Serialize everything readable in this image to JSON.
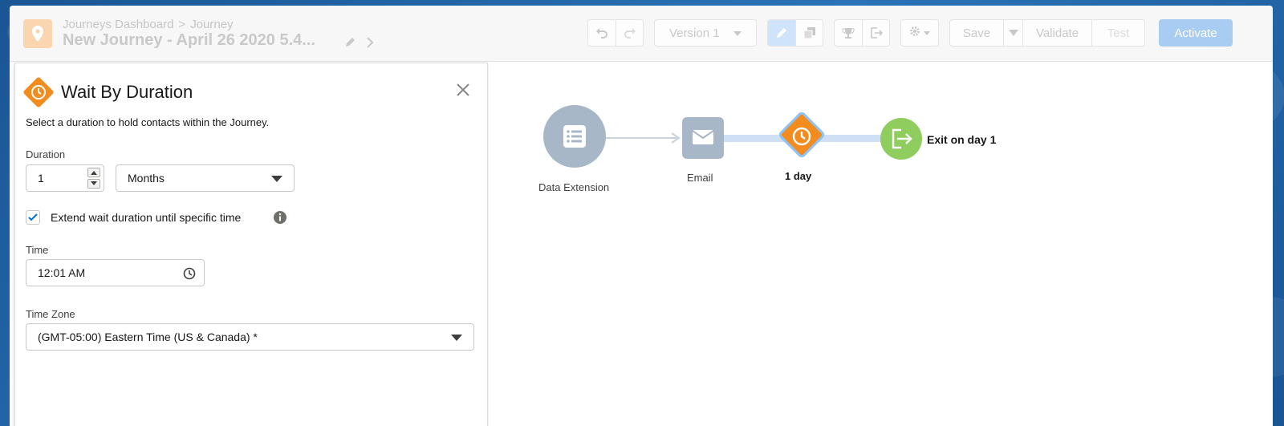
{
  "header": {
    "breadcrumb_root": "Journeys Dashboard",
    "breadcrumb_separator": ">",
    "breadcrumb_current": "Journey",
    "title": "New Journey - April 26 2020 5.4...",
    "version_label": "Version 1",
    "save_label": "Save",
    "validate_label": "Validate",
    "test_label": "Test",
    "activate_label": "Activate",
    "journey_icon": "map-pin-icon"
  },
  "panel": {
    "title": "Wait By Duration",
    "icon": "clock-icon",
    "description": "Select a duration to hold contacts within the Journey.",
    "duration_label": "Duration",
    "duration_value": "1",
    "duration_unit": "Months",
    "extend_checked": true,
    "extend_label": "Extend wait duration until specific time",
    "time_label": "Time",
    "time_value": "12:01 AM",
    "timezone_label": "Time Zone",
    "timezone_value": "(GMT-05:00) Eastern Time (US & Canada) *"
  },
  "canvas": {
    "nodes": [
      {
        "type": "entry",
        "label": "Data Extension",
        "icon": "list-icon",
        "color": "#a8b7c7"
      },
      {
        "type": "email",
        "label": "Email",
        "icon": "envelope-icon",
        "color": "#a8b7c7"
      },
      {
        "type": "wait",
        "label": "1 day",
        "icon": "clock-icon",
        "color": "#f28c1f"
      },
      {
        "type": "exit",
        "label": "Exit on day 1",
        "icon": "exit-icon",
        "color": "#8fce5e"
      }
    ]
  },
  "colors": {
    "accent": "#f28c1f",
    "activate": "#a9cdf2",
    "exit": "#8fce5e",
    "node_gray": "#a8b7c7",
    "edit_active": "#cfe4fa"
  }
}
